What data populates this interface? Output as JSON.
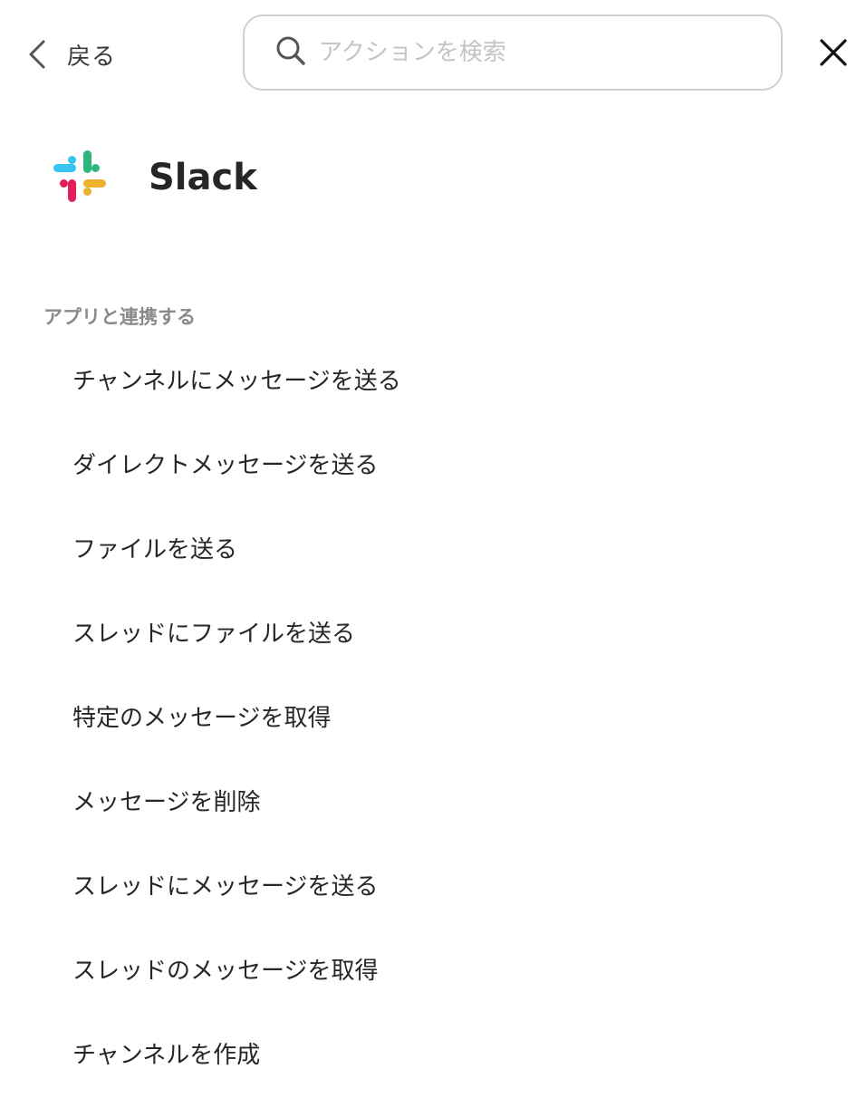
{
  "header": {
    "back_label": "戻る",
    "back_icon": "chevron-left-icon",
    "search_placeholder": "アクションを検索",
    "search_value": "",
    "search_icon": "search-icon",
    "close_icon": "close-icon"
  },
  "app": {
    "name": "Slack",
    "logo_icon": "slack-logo",
    "logo_colors": {
      "blue": "#36C5F0",
      "green": "#2EB67D",
      "yellow": "#ECB22E",
      "red": "#E01E5A"
    }
  },
  "section": {
    "label": "アプリと連携する"
  },
  "actions": [
    {
      "label": "チャンネルにメッセージを送る"
    },
    {
      "label": "ダイレクトメッセージを送る"
    },
    {
      "label": "ファイルを送る"
    },
    {
      "label": "スレッドにファイルを送る"
    },
    {
      "label": "特定のメッセージを取得"
    },
    {
      "label": "メッセージを削除"
    },
    {
      "label": "スレッドにメッセージを送る"
    },
    {
      "label": "スレッドのメッセージを取得"
    },
    {
      "label": "チャンネルを作成"
    }
  ]
}
